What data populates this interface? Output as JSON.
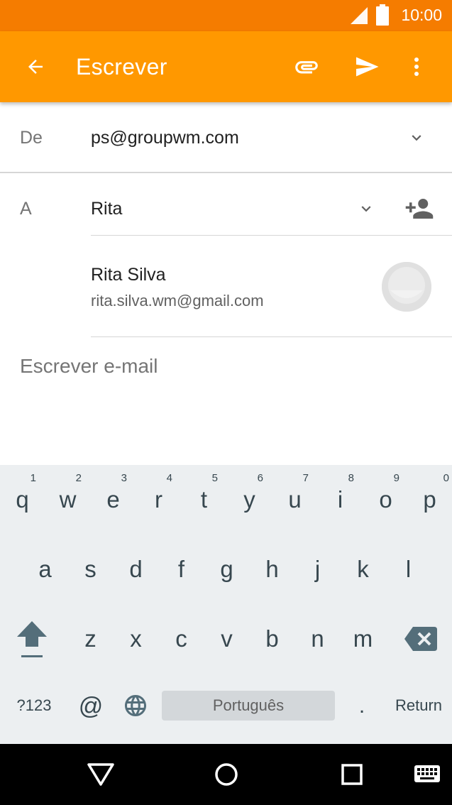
{
  "status_bar": {
    "time": "10:00",
    "icons": [
      "signal-icon",
      "battery-icon"
    ]
  },
  "app_bar": {
    "title": "Escrever",
    "actions": [
      "back-arrow-icon",
      "attach-icon",
      "send-icon",
      "more-vert-icon"
    ]
  },
  "from": {
    "label": "De",
    "value": "ps@groupwm.com"
  },
  "to": {
    "label": "A",
    "value": "Rita"
  },
  "suggestion": {
    "name": "Rita Silva",
    "email": "rita.silva.wm@gmail.com"
  },
  "compose": {
    "placeholder": "Escrever e-mail"
  },
  "keyboard": {
    "row1": [
      {
        "key": "q",
        "hint": "1"
      },
      {
        "key": "w",
        "hint": "2"
      },
      {
        "key": "e",
        "hint": "3"
      },
      {
        "key": "r",
        "hint": "4"
      },
      {
        "key": "t",
        "hint": "5"
      },
      {
        "key": "y",
        "hint": "6"
      },
      {
        "key": "u",
        "hint": "7"
      },
      {
        "key": "i",
        "hint": "8"
      },
      {
        "key": "o",
        "hint": "9"
      },
      {
        "key": "p",
        "hint": "0"
      }
    ],
    "row2": [
      "a",
      "s",
      "d",
      "f",
      "g",
      "h",
      "j",
      "k",
      "l"
    ],
    "row3": [
      "z",
      "x",
      "c",
      "v",
      "b",
      "n",
      "m"
    ],
    "symbols_label": "?123",
    "at_label": "@",
    "space_label": "Português",
    "period_label": ".",
    "return_label": "Return"
  },
  "colors": {
    "status_bar": "#f57c00",
    "app_bar": "#ff9800",
    "keyboard_bg": "#eceff1"
  }
}
